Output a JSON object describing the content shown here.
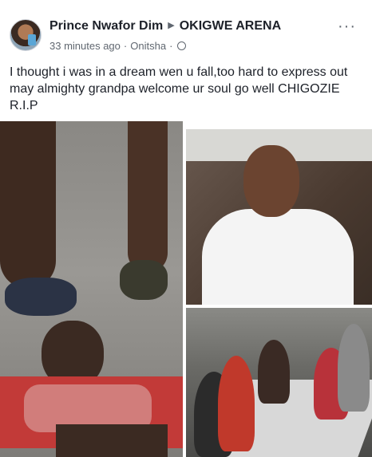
{
  "post": {
    "author": "Prince Nwafor Dim",
    "target": "OKIGWE ARENA",
    "time": "33 minutes ago",
    "location": "Onitsha",
    "text": "I thought i was in a dream wen u fall,too hard to express out may almighty grandpa welcome ur soul go well CHIGOZIE R.I.P",
    "more_icon": "more-horizontal-icon",
    "privacy_icon": "globe-icon",
    "arrow_icon": "triangle-right-icon"
  },
  "colors": {
    "text_primary": "#1d2129",
    "text_secondary": "#606770"
  }
}
